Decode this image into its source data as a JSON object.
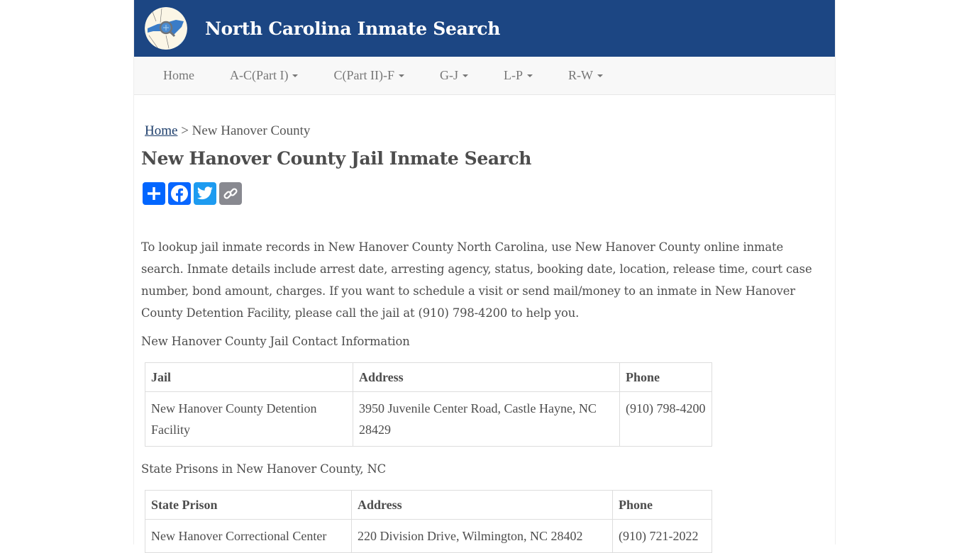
{
  "header": {
    "site_title": "North Carolina Inmate Search",
    "logo_icon": "nc-map-magnifier-logo",
    "colors": {
      "brand": "#1c4683",
      "nav_bg": "#f8f8f8"
    }
  },
  "nav": {
    "items": [
      {
        "label": "Home",
        "dropdown": false
      },
      {
        "label": "A-C(Part I)",
        "dropdown": true
      },
      {
        "label": "C(Part II)-F",
        "dropdown": true
      },
      {
        "label": "G-J",
        "dropdown": true
      },
      {
        "label": "L-P",
        "dropdown": true
      },
      {
        "label": "R-W",
        "dropdown": true
      }
    ]
  },
  "breadcrumb": {
    "home": "Home",
    "separator": " > ",
    "current": "New Hanover County"
  },
  "page_title": "New Hanover County Jail Inmate Search",
  "share": {
    "buttons": [
      {
        "icon": "plus-icon",
        "label": "Share",
        "color": "#0166ff"
      },
      {
        "icon": "facebook-icon",
        "label": "Facebook",
        "color": "#0866ff"
      },
      {
        "icon": "twitter-icon",
        "label": "Twitter",
        "color": "#1d9bf0"
      },
      {
        "icon": "link-icon",
        "label": "Copy Link",
        "color": "#888990"
      }
    ]
  },
  "intro": "To lookup jail inmate records in New Hanover County North Carolina, use New Hanover County online inmate search. Inmate details include arrest date, arresting agency, status, booking date, location, release time, court case number, bond amount, charges. If you want to schedule a visit or send mail/money to an inmate in New Hanover County Detention Facility, please call the jail at (910) 798-4200 to help you.",
  "jail_section": {
    "heading": "New Hanover County Jail Contact Information",
    "columns": [
      "Jail",
      "Address",
      "Phone"
    ],
    "rows": [
      [
        "New Hanover County Detention Facility",
        "3950 Juvenile Center Road, Castle Hayne, NC 28429",
        "(910) 798-4200"
      ]
    ]
  },
  "prison_section": {
    "heading": "State Prisons in New Hanover County, NC",
    "columns": [
      "State Prison",
      "Address",
      "Phone"
    ],
    "rows": [
      [
        "New Hanover Correctional Center",
        "220 Division Drive, Wilmington, NC 28402",
        "(910) 721-2022"
      ]
    ]
  }
}
